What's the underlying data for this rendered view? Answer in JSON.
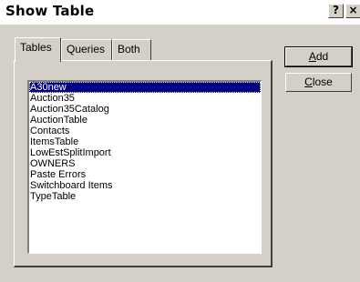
{
  "window": {
    "title": "Show Table",
    "help_glyph": "?",
    "close_glyph": "×"
  },
  "tabs": [
    {
      "label": "Tables",
      "active": true
    },
    {
      "label": "Queries",
      "active": false
    },
    {
      "label": "Both",
      "active": false
    }
  ],
  "list": {
    "items": [
      "A30new",
      "Auction35",
      "Auction35Catalog",
      "AuctionTable",
      "Contacts",
      "ItemsTable",
      "LowEstSplitImport",
      "OWNERS",
      "Paste Errors",
      "Switchboard Items",
      "TypeTable"
    ],
    "selected_index": 0
  },
  "buttons": {
    "add": {
      "mnemonic": "A",
      "rest": "dd"
    },
    "close": {
      "mnemonic": "C",
      "rest": "lose"
    }
  },
  "colors": {
    "face": "#d4d0c8",
    "selection": "#000080"
  }
}
